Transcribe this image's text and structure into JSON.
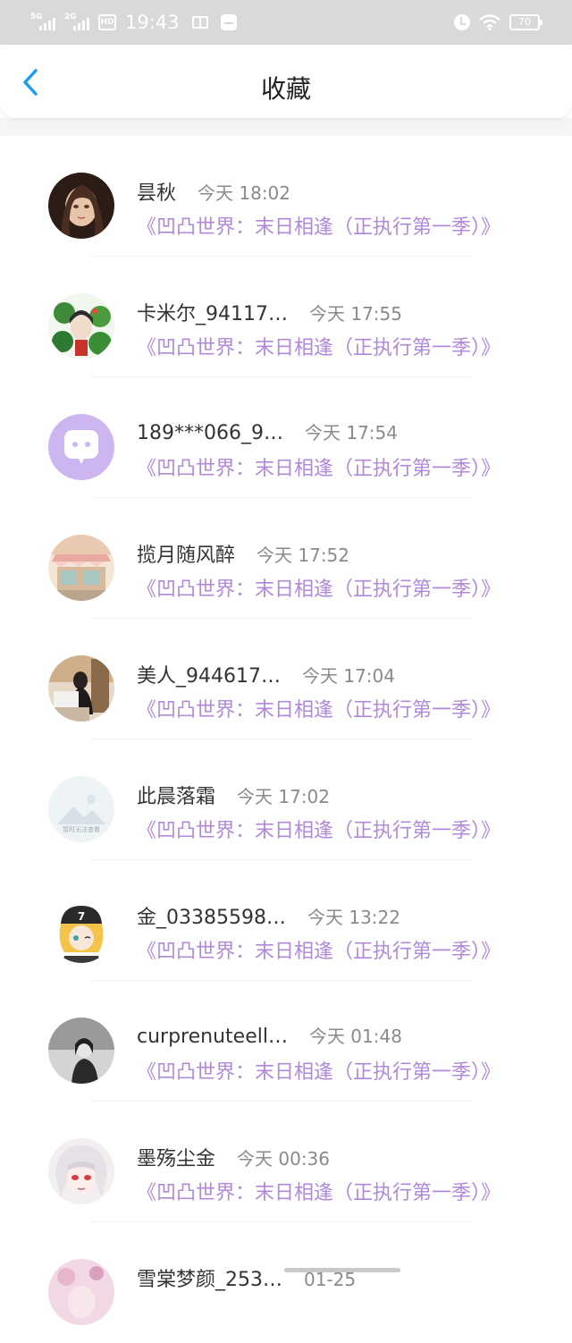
{
  "status_bar": {
    "net1": "5G",
    "net2": "2G",
    "hd": "HD",
    "time": "19:43",
    "battery": "70"
  },
  "header": {
    "title": "收藏",
    "back_icon": "chevron-left-icon"
  },
  "colors": {
    "accent_back": "#1aa0e6",
    "work_title": "#b08ad8",
    "name": "#333333",
    "time": "#8a8a8a"
  },
  "favorites": [
    {
      "name": "昙秋",
      "time": "今天 18:02",
      "work": "《凹凸世界：末日相逢（正执行第一季）》"
    },
    {
      "name": "卡米尔_94117…",
      "time": "今天 17:55",
      "work": "《凹凸世界：末日相逢（正执行第一季）》"
    },
    {
      "name": "189***066_9…",
      "time": "今天 17:54",
      "work": "《凹凸世界：末日相逢（正执行第一季）》"
    },
    {
      "name": "揽月随风醉",
      "time": "今天 17:52",
      "work": "《凹凸世界：末日相逢（正执行第一季）》"
    },
    {
      "name": "美人_944617…",
      "time": "今天 17:04",
      "work": "《凹凸世界：末日相逢（正执行第一季）》"
    },
    {
      "name": "此晨落霜",
      "time": "今天 17:02",
      "work": "《凹凸世界：末日相逢（正执行第一季）》"
    },
    {
      "name": "金_03385598…",
      "time": "今天 13:22",
      "work": "《凹凸世界：末日相逢（正执行第一季）》"
    },
    {
      "name": "curprenuteell…",
      "time": "今天 01:48",
      "work": "《凹凸世界：末日相逢（正执行第一季）》"
    },
    {
      "name": "墨殇尘金",
      "time": "今天 00:36",
      "work": "《凹凸世界：末日相逢（正执行第一季）》"
    },
    {
      "name": "雪棠梦颜_253…",
      "time": "01-25",
      "work": ""
    }
  ],
  "placeholder_avatar_text": "暂时无法查看"
}
